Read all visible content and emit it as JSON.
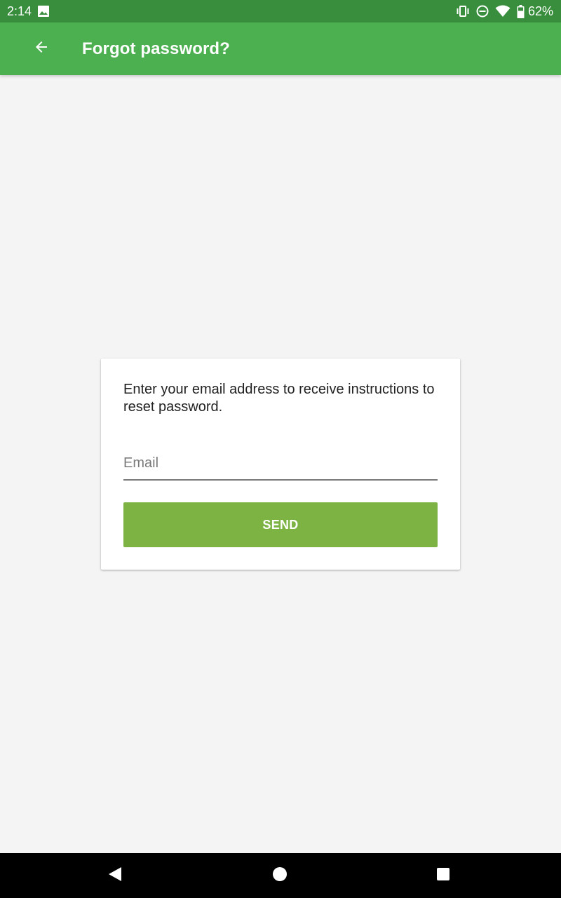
{
  "status_bar": {
    "time": "2:14",
    "left_icons": [
      "image-notification-icon"
    ],
    "right_icons": [
      "vibrate-icon",
      "do-not-disturb-icon",
      "wifi-icon",
      "battery-icon"
    ],
    "battery_percent": "62%"
  },
  "app_bar": {
    "title": "Forgot password?",
    "back_icon": "arrow-back-icon"
  },
  "card": {
    "instructions": "Enter your email address to receive instructions to reset password.",
    "email": {
      "value": "",
      "placeholder": "Email"
    },
    "send_label": "SEND"
  },
  "nav_bar": {
    "buttons": [
      "back-triangle-icon",
      "home-circle-icon",
      "recents-square-icon"
    ]
  },
  "colors": {
    "status_bar": "#388e3c",
    "app_bar": "#4caf50",
    "send_button": "#7cb342",
    "background": "#f4f4f4"
  }
}
